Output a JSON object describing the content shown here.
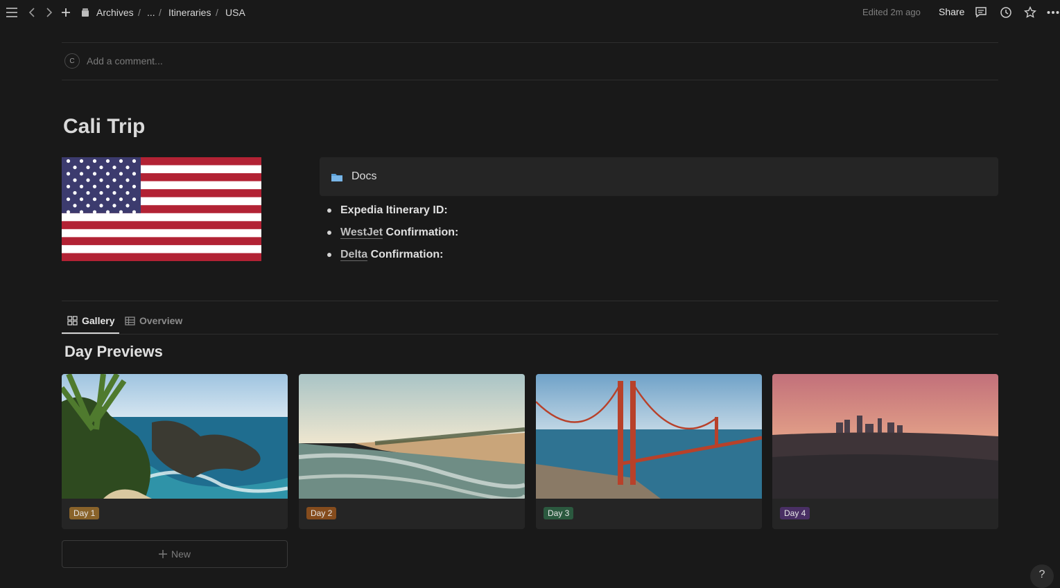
{
  "breadcrumb": {
    "items": [
      "Archives",
      "...",
      "Itineraries",
      "USA"
    ],
    "separator": "/"
  },
  "header": {
    "edited": "Edited 2m ago",
    "share_label": "Share"
  },
  "comment": {
    "avatar_initial": "C",
    "placeholder": "Add a comment..."
  },
  "page": {
    "title": "Cali Trip"
  },
  "callout": {
    "label": "Docs"
  },
  "bullets": [
    {
      "prefix": "",
      "link": "",
      "suffix": "Expedia Itinerary ID:"
    },
    {
      "prefix": "",
      "link": "WestJet",
      "suffix": " Confirmation:"
    },
    {
      "prefix": "",
      "link": "Delta",
      "suffix": " Confirmation:"
    }
  ],
  "tabs": [
    {
      "label": "Gallery",
      "active": true
    },
    {
      "label": "Overview",
      "active": false
    }
  ],
  "gallery": {
    "heading": "Day Previews",
    "cards": [
      {
        "tag": "Day 1",
        "tag_color": "#89632a",
        "scene": "coast-waterfall"
      },
      {
        "tag": "Day 2",
        "tag_color": "#854c1d",
        "scene": "beach"
      },
      {
        "tag": "Day 3",
        "tag_color": "#2b593f",
        "scene": "golden-gate"
      },
      {
        "tag": "Day 4",
        "tag_color": "#492f64",
        "scene": "city-skyline"
      }
    ],
    "new_label": "New"
  },
  "colors": {
    "background": "#191919",
    "card": "#252525",
    "text": "#d4d4d4"
  },
  "help": {
    "label": "?"
  }
}
